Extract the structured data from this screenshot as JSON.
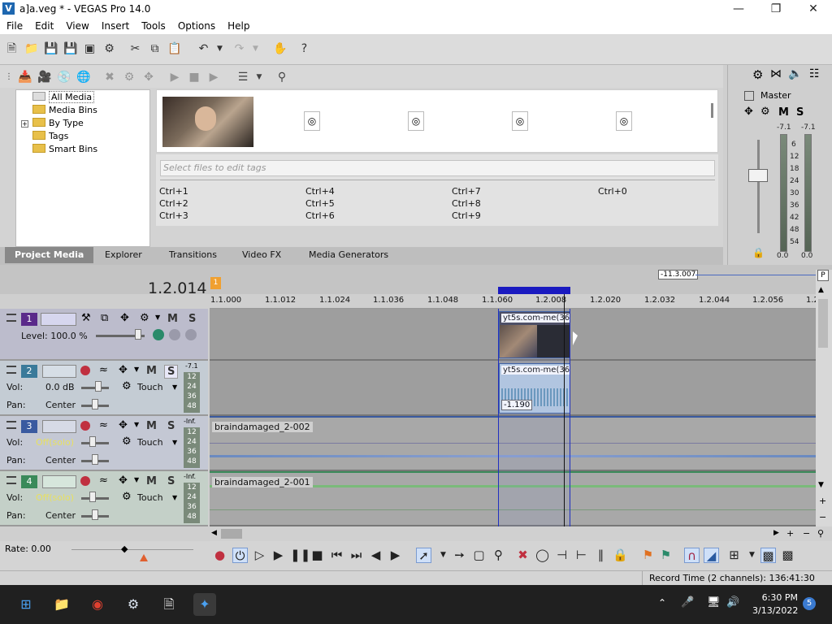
{
  "window": {
    "title": "a]a.veg * - VEGAS Pro 14.0",
    "app_icon": "vegas-icon"
  },
  "menu": [
    "File",
    "Edit",
    "View",
    "Insert",
    "Tools",
    "Options",
    "Help"
  ],
  "media_tree": [
    "All Media",
    "Media Bins",
    "By Type",
    "Tags",
    "Smart Bins"
  ],
  "tags": {
    "placeholder": "Select files to edit tags",
    "shortcuts": [
      "Ctrl+1",
      "Ctrl+2",
      "Ctrl+3",
      "Ctrl+4",
      "Ctrl+5",
      "Ctrl+6",
      "Ctrl+7",
      "Ctrl+8",
      "Ctrl+9",
      "Ctrl+0"
    ]
  },
  "tabs": [
    "Project Media",
    "Explorer",
    "Transitions",
    "Video FX",
    "Media Generators"
  ],
  "mixer": {
    "title": "Master",
    "mute": "M",
    "solo": "S",
    "peak_left": "-7.1",
    "peak_right": "-7.1",
    "scale": [
      "6",
      "12",
      "18",
      "24",
      "30",
      "36",
      "42",
      "48",
      "54"
    ],
    "bottom_left": "0.0",
    "bottom_right": "0.0"
  },
  "timeline": {
    "timecode": "1.2.014",
    "ruler": [
      "1.1.000",
      "1.1.012",
      "1.1.024",
      "1.1.036",
      "1.1.048",
      "1.1.060",
      "1.2.008",
      "1.2.020",
      "1.2.032",
      "1.2.044",
      "1.2.056",
      "1.2."
    ],
    "loop_length": "-11.3.007",
    "marker": "1"
  },
  "tracks": [
    {
      "num": "1",
      "level_label": "Level: 100.0 %",
      "mute": "M",
      "solo": "S"
    },
    {
      "num": "2",
      "vol_label": "Vol:",
      "vol_value": "0.0 dB",
      "pan_label": "Pan:",
      "pan_value": "Center",
      "mode": "Touch",
      "mute": "M",
      "solo": "S",
      "peak": "-7.1",
      "meter": [
        "12",
        "24",
        "36",
        "48"
      ]
    },
    {
      "num": "3",
      "vol_label": "Vol:",
      "vol_value": "Off(solo)",
      "pan_label": "Pan:",
      "pan_value": "Center",
      "mode": "Touch",
      "mute": "M",
      "solo": "S",
      "peak": "-Inf.",
      "meter": [
        "12",
        "24",
        "36",
        "48"
      ]
    },
    {
      "num": "4",
      "vol_label": "Vol:",
      "vol_value": "Off(solo)",
      "pan_label": "Pan:",
      "pan_value": "Center",
      "mode": "Touch",
      "mute": "M",
      "solo": "S",
      "peak": "-Inf.",
      "meter": [
        "12",
        "24",
        "36",
        "48"
      ]
    }
  ],
  "events": {
    "video_clip": "yt5s.com-me(360",
    "audio_clip": "yt5s.com-me(36",
    "audio_gain": "-1.190",
    "track3_clip": "braindamaged_2-002",
    "track4_clip": "braindamaged_2-001"
  },
  "transport": {
    "rate": "Rate: 0.00"
  },
  "status": {
    "record_time": "Record Time (2 channels): 136:41:30"
  },
  "taskbar": {
    "time": "6:30 PM",
    "date": "3/13/2022",
    "notif": "5"
  },
  "colors": {
    "accent": "#1a1ac0",
    "video_track": "#5a2a8a",
    "audio_track2": "#3a7a9a",
    "audio_track3": "#3a5aa0",
    "audio_track4": "#3a8a5a",
    "solo_yellow": "#e8e060"
  }
}
